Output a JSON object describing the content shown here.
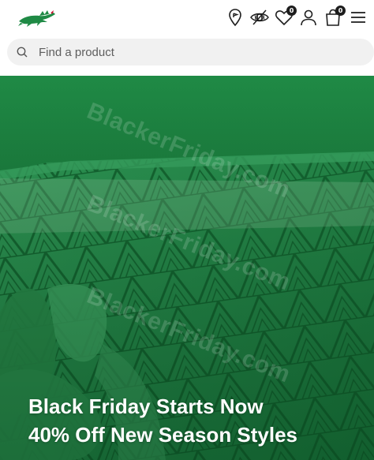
{
  "header": {
    "logo_name": "crocodile-logo",
    "icons": [
      "store-locator-icon",
      "accessibility-icon",
      "wishlist-icon",
      "account-icon",
      "cart-icon",
      "menu-icon"
    ],
    "wishlist_count": "0",
    "cart_count": "0"
  },
  "search": {
    "placeholder": "Find a product"
  },
  "hero": {
    "watermark": "BlackerFriday.com",
    "headline_line1": "Black Friday Starts Now",
    "headline_line2": "40% Off New Season Styles"
  },
  "colors": {
    "brand_green": "#1f8a45",
    "hero_dark_green": "#17703a",
    "text_dark": "#1d1d1d"
  }
}
